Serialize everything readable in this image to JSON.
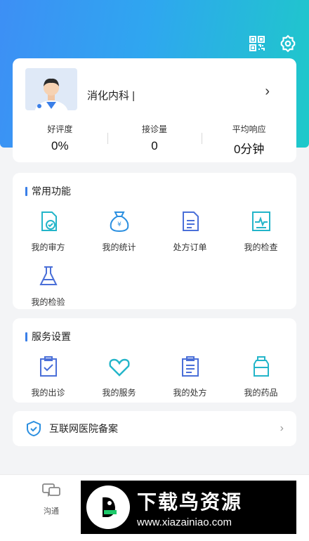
{
  "header": {
    "qr_icon": "qr-code-icon",
    "settings_icon": "gear-icon"
  },
  "profile": {
    "department": "消化内科 |",
    "stats": [
      {
        "label": "好评度",
        "value": "0%"
      },
      {
        "label": "接诊量",
        "value": "0"
      },
      {
        "label": "平均响应",
        "value": "0分钟"
      }
    ]
  },
  "common_functions": {
    "title": "常用功能",
    "items": [
      {
        "label": "我的审方",
        "icon": "review-prescription-icon"
      },
      {
        "label": "我的统计",
        "icon": "money-bag-icon"
      },
      {
        "label": "处方订单",
        "icon": "document-icon"
      },
      {
        "label": "我的检查",
        "icon": "ecg-report-icon"
      },
      {
        "label": "我的检验",
        "icon": "flask-icon"
      }
    ]
  },
  "service_settings": {
    "title": "服务设置",
    "items": [
      {
        "label": "我的出诊",
        "icon": "clipboard-check-icon"
      },
      {
        "label": "我的服务",
        "icon": "heart-icon"
      },
      {
        "label": "我的处方",
        "icon": "prescription-list-icon"
      },
      {
        "label": "我的药品",
        "icon": "medicine-bottle-icon"
      }
    ]
  },
  "record": {
    "label": "互联网医院备案"
  },
  "tabbar": {
    "items": [
      {
        "label": "沟通"
      }
    ]
  },
  "watermark": {
    "title": "下载鸟资源",
    "url": "www.xiazainiao.com"
  },
  "colors": {
    "primary": "#3a7fe8",
    "accent_teal": "#1ec9c9"
  }
}
